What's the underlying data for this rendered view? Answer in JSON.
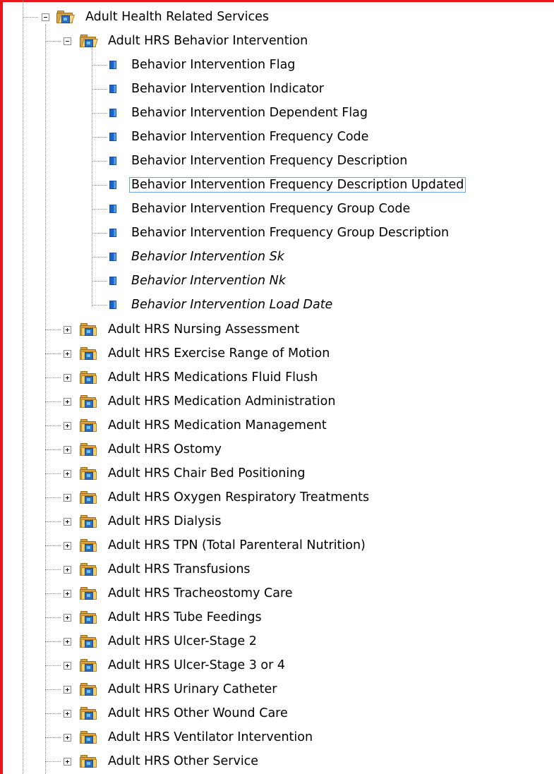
{
  "tree": {
    "root": {
      "label": "Adult Health Related Services",
      "expanded": true,
      "icon": "folder-open-icon"
    },
    "open_group": {
      "label": "Adult HRS Behavior Intervention",
      "expanded": true,
      "icon": "folder-open-icon",
      "attributes": [
        {
          "label": "Behavior Intervention Flag",
          "italic": false,
          "selected": false
        },
        {
          "label": "Behavior Intervention Indicator",
          "italic": false,
          "selected": false
        },
        {
          "label": "Behavior Intervention Dependent Flag",
          "italic": false,
          "selected": false
        },
        {
          "label": "Behavior Intervention Frequency Code",
          "italic": false,
          "selected": false
        },
        {
          "label": "Behavior Intervention Frequency Description",
          "italic": false,
          "selected": false
        },
        {
          "label": "Behavior Intervention Frequency Description Updated",
          "italic": false,
          "selected": true
        },
        {
          "label": "Behavior Intervention Frequency Group Code",
          "italic": false,
          "selected": false
        },
        {
          "label": "Behavior Intervention Frequency Group Description",
          "italic": false,
          "selected": false
        },
        {
          "label": "Behavior Intervention Sk",
          "italic": true,
          "selected": false
        },
        {
          "label": "Behavior Intervention Nk",
          "italic": true,
          "selected": false
        },
        {
          "label": "Behavior Intervention Load Date",
          "italic": true,
          "selected": false
        }
      ]
    },
    "collapsed_groups": [
      "Adult HRS Nursing Assessment",
      "Adult HRS Exercise Range of Motion",
      "Adult HRS Medications Fluid Flush",
      "Adult HRS Medication Administration",
      "Adult HRS Medication Management",
      "Adult HRS Ostomy",
      "Adult HRS Chair Bed Positioning",
      "Adult HRS Oxygen Respiratory Treatments",
      "Adult HRS Dialysis",
      "Adult HRS TPN (Total Parenteral Nutrition)",
      "Adult HRS Transfusions",
      "Adult HRS Tracheostomy Care",
      "Adult HRS Tube Feedings",
      "Adult HRS Ulcer-Stage 2",
      "Adult HRS Ulcer-Stage 3 or 4",
      "Adult HRS Urinary Catheter",
      "Adult HRS Other Wound Care",
      "Adult HRS Ventilator Intervention",
      "Adult HRS Other Service"
    ]
  },
  "colors": {
    "frame_border": "#e8161c",
    "selection_outline": "#6aa6e0",
    "attribute_icon": "#1b62c8"
  }
}
